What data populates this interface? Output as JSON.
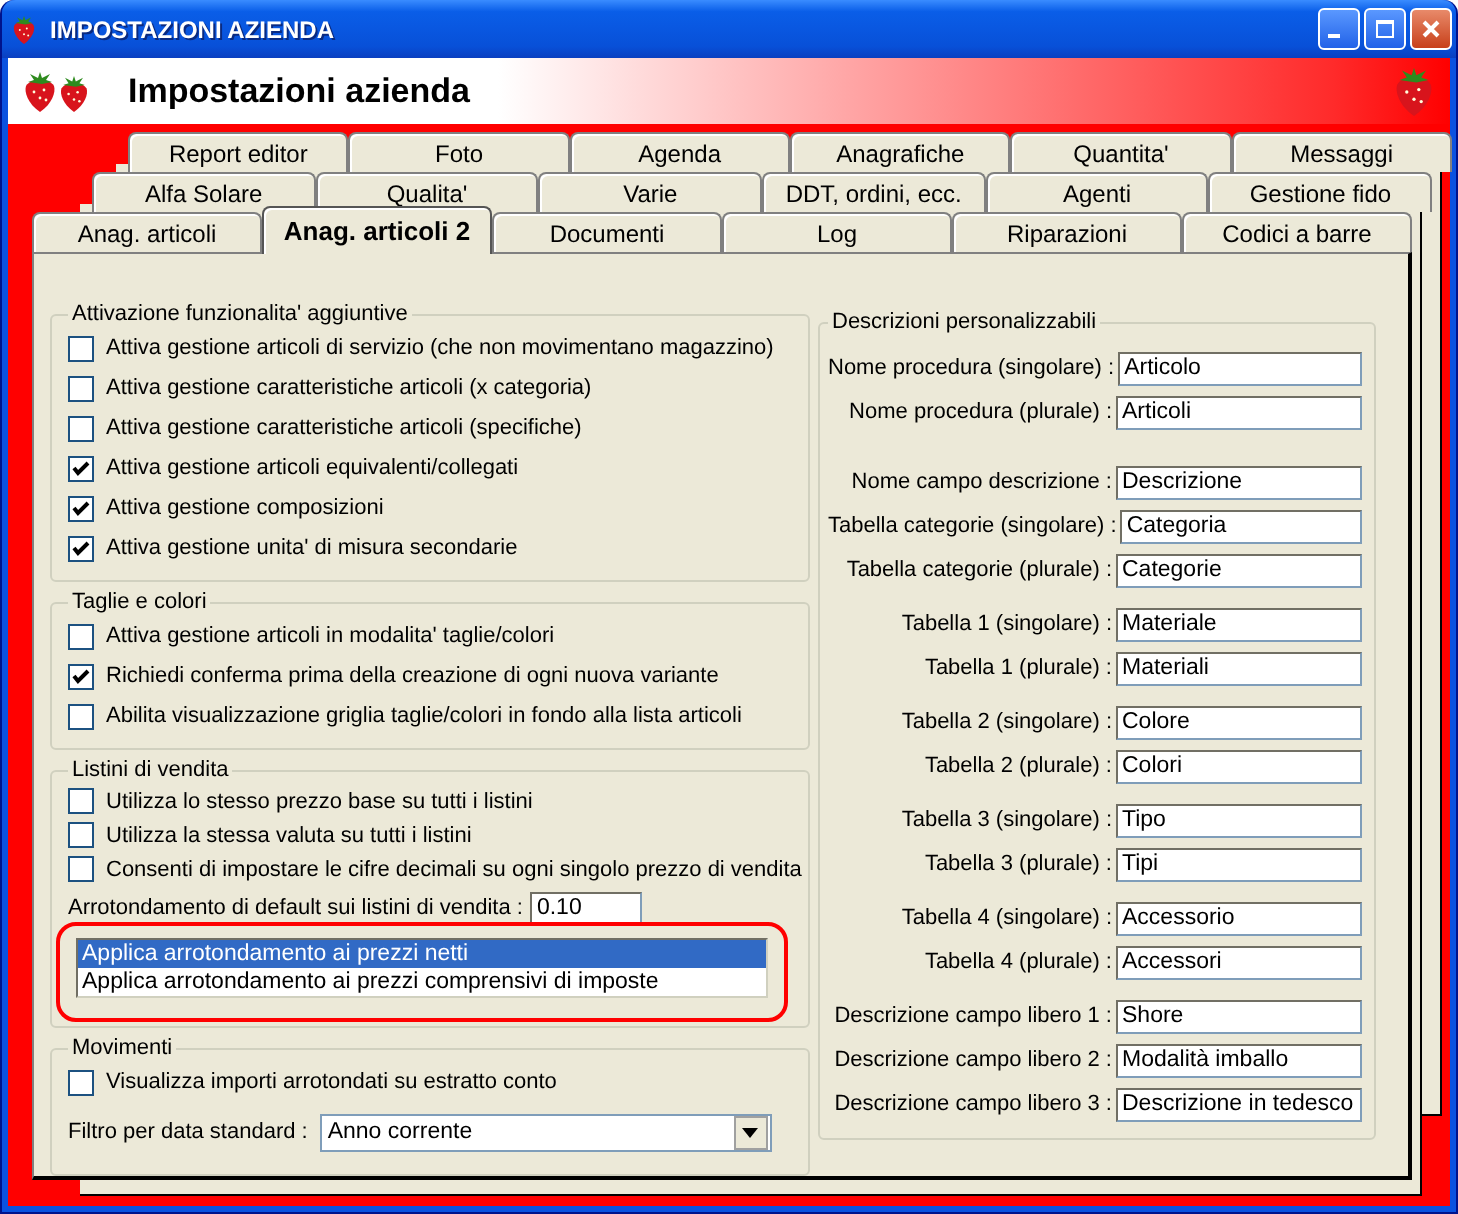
{
  "window": {
    "title": "IMPOSTAZIONI AZIENDA"
  },
  "header": {
    "title": "Impostazioni azienda"
  },
  "tab_rows": [
    [
      {
        "label": "Report editor",
        "selected": false
      },
      {
        "label": "Foto",
        "selected": false
      },
      {
        "label": "Agenda",
        "selected": false
      },
      {
        "label": "Anagrafiche",
        "selected": false
      },
      {
        "label": "Quantita'",
        "selected": false
      },
      {
        "label": "Messaggi",
        "selected": false
      }
    ],
    [
      {
        "label": "Alfa Solare",
        "selected": false
      },
      {
        "label": "Qualita'",
        "selected": false
      },
      {
        "label": "Varie",
        "selected": false
      },
      {
        "label": "DDT, ordini, ecc.",
        "selected": false
      },
      {
        "label": "Agenti",
        "selected": false
      },
      {
        "label": "Gestione fido",
        "selected": false
      }
    ],
    [
      {
        "label": "Anag. articoli",
        "selected": false
      },
      {
        "label": "Anag. articoli 2",
        "selected": true
      },
      {
        "label": "Documenti",
        "selected": false
      },
      {
        "label": "Log",
        "selected": false
      },
      {
        "label": "Riparazioni",
        "selected": false
      },
      {
        "label": "Codici a barre",
        "selected": false
      }
    ]
  ],
  "left_groups": [
    {
      "title": "Attivazione funzionalita' aggiuntive",
      "items": [
        {
          "kind": "checkbox",
          "label": "Attiva gestione articoli di servizio (che non movimentano magazzino)",
          "checked": false
        },
        {
          "kind": "checkbox",
          "label": "Attiva gestione caratteristiche articoli (x categoria)",
          "checked": false
        },
        {
          "kind": "checkbox",
          "label": "Attiva gestione caratteristiche articoli (specifiche)",
          "checked": false
        },
        {
          "kind": "checkbox",
          "label": "Attiva gestione articoli equivalenti/collegati",
          "checked": true
        },
        {
          "kind": "checkbox",
          "label": "Attiva gestione composizioni",
          "checked": true
        },
        {
          "kind": "checkbox",
          "label": "Attiva gestione unita' di misura secondarie",
          "checked": true
        }
      ]
    },
    {
      "title": "Taglie e colori",
      "items": [
        {
          "kind": "checkbox",
          "label": "Attiva gestione articoli in modalita' taglie/colori",
          "checked": false
        },
        {
          "kind": "checkbox",
          "label": "Richiedi conferma prima della creazione di ogni nuova variante",
          "checked": true
        },
        {
          "kind": "checkbox",
          "label": "Abilita visualizzazione griglia taglie/colori in fondo alla lista articoli",
          "checked": false
        }
      ]
    },
    {
      "title": "Listini di vendita",
      "items": [
        {
          "kind": "checkbox",
          "label": "Utilizza lo stesso prezzo base su tutti i listini",
          "checked": false
        },
        {
          "kind": "checkbox",
          "label": "Utilizza la stessa valuta su tutti i listini",
          "checked": false
        },
        {
          "kind": "checkbox",
          "label": "Consenti di impostare le cifre decimali su ogni singolo prezzo di vendita",
          "checked": false
        },
        {
          "kind": "field",
          "label": "Arrotondamento di default sui listini di vendita :",
          "value": "0.10"
        },
        {
          "kind": "listbox",
          "highlighted": true,
          "options": [
            {
              "label": "Applica arrotondamento ai prezzi netti",
              "selected": true
            },
            {
              "label": "Applica arrotondamento ai prezzi comprensivi di imposte",
              "selected": false
            }
          ]
        }
      ]
    },
    {
      "title": "Movimenti",
      "items": [
        {
          "kind": "checkbox",
          "label": "Visualizza importi arrotondati su estratto conto",
          "checked": false
        },
        {
          "kind": "dropdown",
          "label": "Filtro per data standard :",
          "value": "Anno corrente"
        }
      ]
    }
  ],
  "right_group": {
    "title": "Descrizioni personalizzabili",
    "sections": [
      [
        {
          "label": "Nome procedura (singolare) :",
          "value": "Articolo"
        },
        {
          "label": "Nome procedura (plurale) :",
          "value": "Articoli"
        }
      ],
      [
        {
          "label": "Nome campo descrizione :",
          "value": "Descrizione"
        },
        {
          "label": "Tabella categorie (singolare) :",
          "value": "Categoria"
        },
        {
          "label": "Tabella categorie (plurale) :",
          "value": "Categorie"
        }
      ],
      [
        {
          "label": "Tabella 1 (singolare) :",
          "value": "Materiale"
        },
        {
          "label": "Tabella 1 (plurale) :",
          "value": "Materiali"
        }
      ],
      [
        {
          "label": "Tabella 2 (singolare) :",
          "value": "Colore"
        },
        {
          "label": "Tabella 2 (plurale) :",
          "value": "Colori"
        }
      ],
      [
        {
          "label": "Tabella 3 (singolare) :",
          "value": "Tipo"
        },
        {
          "label": "Tabella 3 (plurale) :",
          "value": "Tipi"
        }
      ],
      [
        {
          "label": "Tabella 4 (singolare) :",
          "value": "Accessorio"
        },
        {
          "label": "Tabella 4 (plurale) :",
          "value": "Accessori"
        }
      ],
      [
        {
          "label": "Descrizione campo libero 1 :",
          "value": "Shore"
        },
        {
          "label": "Descrizione campo libero 2 :",
          "value": "Modalità imballo"
        },
        {
          "label": "Descrizione campo libero 3 :",
          "value": "Descrizione in tedesco"
        }
      ]
    ]
  }
}
